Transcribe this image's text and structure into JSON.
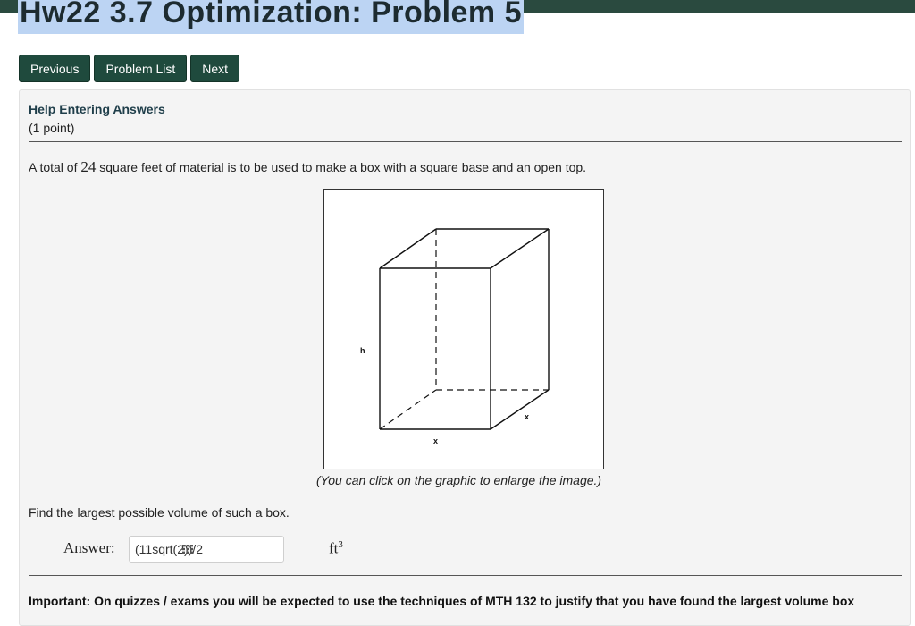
{
  "header": {
    "title": "Hw22 3.7 Optimization: Problem 5"
  },
  "nav": {
    "previous": "Previous",
    "problem_list": "Problem List",
    "next": "Next"
  },
  "problem": {
    "help_link": "Help Entering Answers",
    "points": "(1 point)",
    "statement_before": "A total of ",
    "statement_number": "24",
    "statement_after": " square feet of material is to be used to make a box with a square base and an open top.",
    "figure": {
      "label_h": "h",
      "label_x_front": "x",
      "label_x_side": "x"
    },
    "figure_caption": "(You can click on the graphic to enlarge the image.)",
    "question": "Find the largest possible volume of such a box.",
    "answer_label": "Answer:",
    "answer_value": "(11sqrt(2))/2",
    "unit_base": "ft",
    "unit_exp": "3",
    "important": "Important: On quizzes / exams you will be expected to use the techniques of MTH 132 to justify that you have found the largest volume box"
  },
  "colors": {
    "topbar": "#2a4a3f",
    "button": "#1f4a3d",
    "title_highlight": "#bcd4f3",
    "panel": "#f4f4f4"
  },
  "icons": {
    "equation_editor": "grid-icon"
  }
}
